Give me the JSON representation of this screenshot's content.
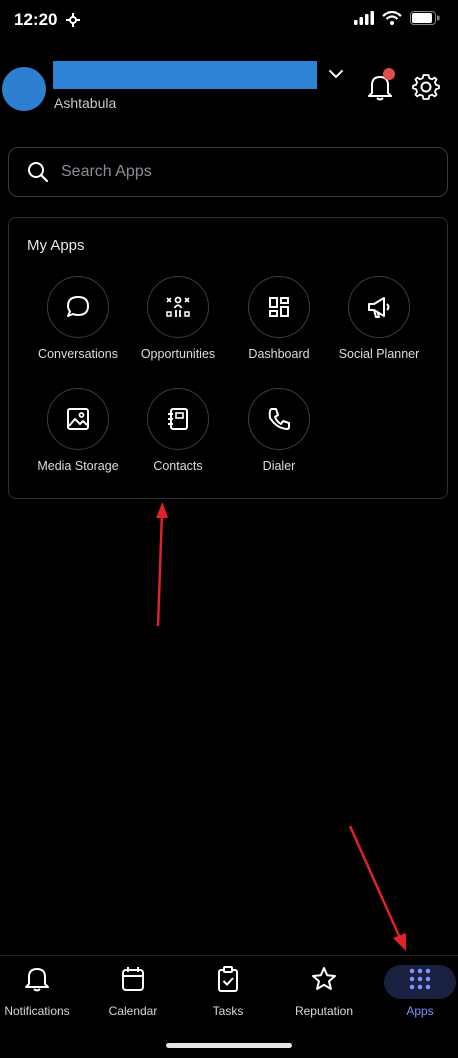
{
  "status_bar": {
    "time": "12:20"
  },
  "header": {
    "location": "Ashtabula"
  },
  "search": {
    "placeholder": "Search Apps"
  },
  "my_apps": {
    "title": "My Apps",
    "apps": [
      {
        "label": "Conversations",
        "icon": "chat-bubble-icon"
      },
      {
        "label": "Opportunities",
        "icon": "opportunities-icon"
      },
      {
        "label": "Dashboard",
        "icon": "dashboard-grid-icon"
      },
      {
        "label": "Social Planner",
        "icon": "megaphone-icon"
      },
      {
        "label": "Media Storage",
        "icon": "image-icon"
      },
      {
        "label": "Contacts",
        "icon": "contacts-book-icon"
      },
      {
        "label": "Dialer",
        "icon": "phone-icon"
      }
    ]
  },
  "bottom_nav": {
    "items": [
      {
        "label": "Notifications",
        "icon": "bell-icon"
      },
      {
        "label": "Calendar",
        "icon": "calendar-icon"
      },
      {
        "label": "Tasks",
        "icon": "clipboard-check-icon"
      },
      {
        "label": "Reputation",
        "icon": "star-icon"
      },
      {
        "label": "Apps",
        "icon": "apps-grid-icon",
        "active": true
      }
    ]
  },
  "colors": {
    "background": "#000000",
    "accent": "#7f90ff",
    "avatar": "#2f7fd0",
    "notification_dot": "#e34b4f",
    "annotation_arrow": "#e0232a"
  }
}
